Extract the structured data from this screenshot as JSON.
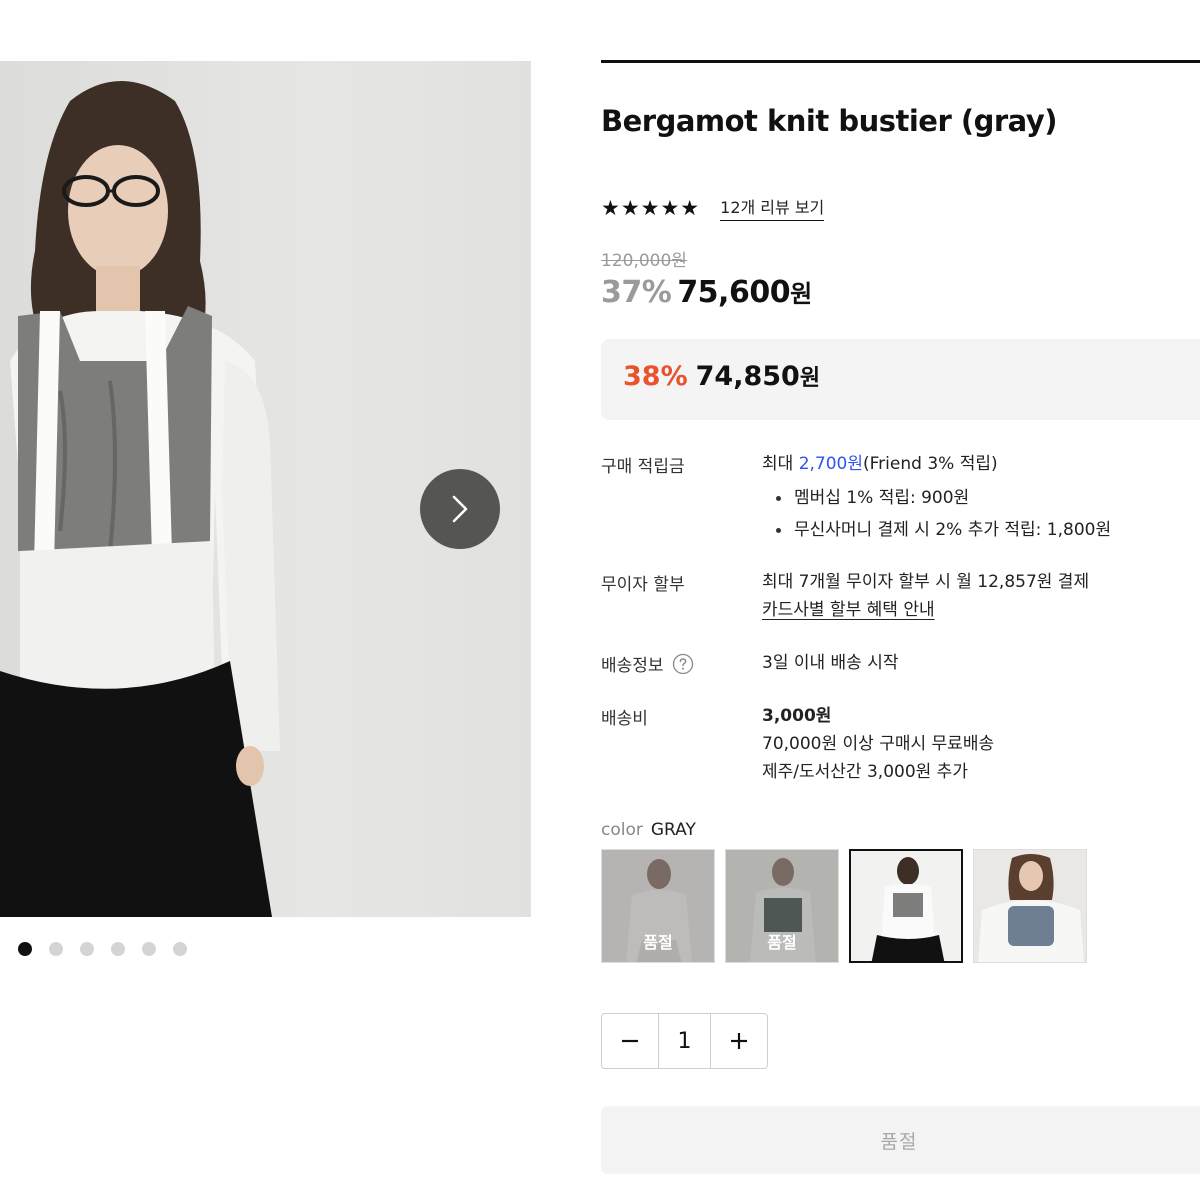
{
  "product": {
    "title": "Bergamot knit bustier (gray)",
    "stars": "★★★★★",
    "rating_value": 5,
    "review_link": "12개 리뷰 보기",
    "original_price": "120,000원",
    "discount_rate": "37%",
    "sale_price_number": "75,600",
    "sale_price_unit": "원"
  },
  "benefit": {
    "rate": "38%",
    "price_number": "74,850",
    "price_unit": "원",
    "rate_color": "#e8532d"
  },
  "points": {
    "label": "구매 적립금",
    "prefix": "최대 ",
    "amount": "2,700원",
    "suffix": "(Friend 3% 적립)",
    "bullets": [
      "멤버십 1% 적립: 900원",
      "무신사머니 결제 시 2% 추가 적립: 1,800원"
    ],
    "amount_color": "#2f54eb"
  },
  "installment": {
    "label": "무이자 할부",
    "text": "최대 7개월 무이자 할부 시 월 12,857원 결제",
    "link": "카드사별 할부 혜택 안내"
  },
  "shipping": {
    "label": "배송정보",
    "text": "3일 이내 배송 시작"
  },
  "shipping_fee": {
    "label": "배송비",
    "fee": "3,000원",
    "free_condition": "70,000원 이상 구매시 무료배송",
    "extra": "제주/도서산간 3,000원 추가"
  },
  "color_option": {
    "label": "color",
    "selected": "GRAY",
    "swatches": [
      {
        "soldout_label": "품절"
      },
      {
        "soldout_label": "품절"
      },
      {
        "soldout_label": ""
      },
      {
        "soldout_label": ""
      }
    ]
  },
  "quantity": {
    "minus": "−",
    "value": "1",
    "plus": "+"
  },
  "buy_button": {
    "label": "품절"
  },
  "gallery": {
    "image_count": 6,
    "active_index": 0
  }
}
